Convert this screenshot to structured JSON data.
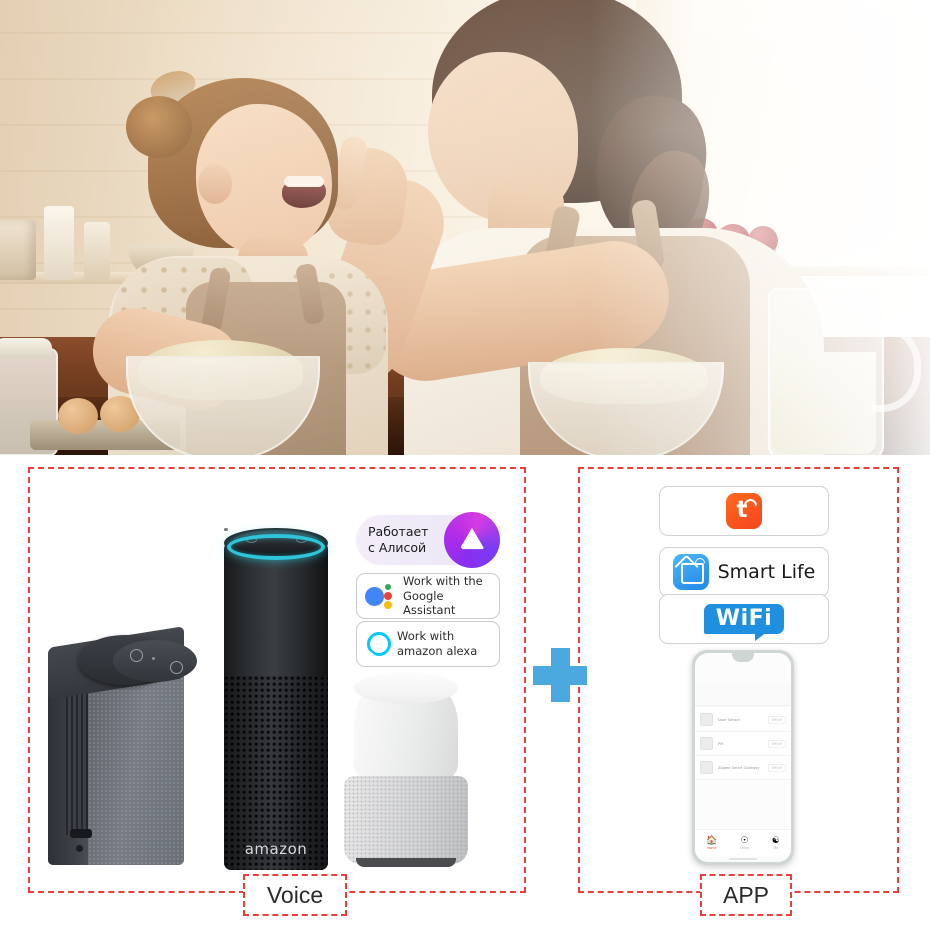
{
  "hero": {
    "alt": "Mother and daughter laughing while baking dough together in a bright kitchen",
    "scene_items": [
      "girl",
      "woman",
      "mixing-bowls",
      "eggs",
      "milk-pitcher",
      "fruit-basket",
      "kitchen-shelf"
    ]
  },
  "panels": {
    "left": {
      "caption": "Voice",
      "devices": [
        "yandex-station",
        "amazon-echo",
        "google-home"
      ],
      "echo_wordmark": "amazon",
      "badges": [
        {
          "id": "alice",
          "line1": "Работает",
          "line2": "с Алисой",
          "icon": "yandex-alice-icon"
        },
        {
          "id": "google-assistant",
          "line1": "Work with the",
          "line2": "Google Assistant",
          "icon": "google-assistant-icon"
        },
        {
          "id": "amazon-alexa",
          "line1": "Work with",
          "line2": "amazon alexa",
          "icon": "alexa-ring-icon"
        }
      ]
    },
    "right": {
      "caption": "APP",
      "badges": [
        {
          "id": "tuya",
          "label": "t",
          "icon": "tuya-icon"
        },
        {
          "id": "smart-life",
          "label": "Smart Life",
          "icon": "smart-life-icon"
        },
        {
          "id": "wifi",
          "label": "WiFi",
          "icon": "wifi-icon"
        }
      ],
      "phone": {
        "devices": [
          {
            "name": "Door Sensor",
            "status": "Offline"
          },
          {
            "name": "PIR",
            "status": "Offline"
          },
          {
            "name": "Zigbee Smart Gateway",
            "status": "Offline"
          }
        ],
        "nav": [
          {
            "label": "Home",
            "icon": "home-icon",
            "active": true
          },
          {
            "label": "Smart",
            "icon": "smart-icon",
            "active": false
          },
          {
            "label": "Me",
            "icon": "me-icon",
            "active": false
          }
        ]
      }
    }
  },
  "connector": {
    "symbol": "+",
    "color": "#4ba9e0"
  },
  "colors": {
    "dashed_border": "#e8403a",
    "plus": "#4ba9e0",
    "tuya_orange": "#f4441d",
    "smart_life_blue": "#1e86e8",
    "wifi_blue": "#1f8fe0",
    "echo_ring": "#2ec4d9"
  }
}
